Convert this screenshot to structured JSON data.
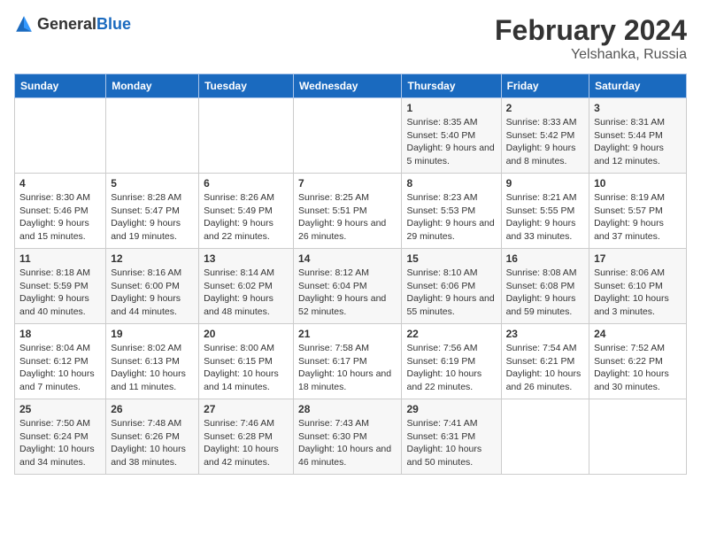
{
  "logo": {
    "text_general": "General",
    "text_blue": "Blue"
  },
  "title": "February 2024",
  "subtitle": "Yelshanka, Russia",
  "days_of_week": [
    "Sunday",
    "Monday",
    "Tuesday",
    "Wednesday",
    "Thursday",
    "Friday",
    "Saturday"
  ],
  "weeks": [
    [
      {
        "day": "",
        "info": ""
      },
      {
        "day": "",
        "info": ""
      },
      {
        "day": "",
        "info": ""
      },
      {
        "day": "",
        "info": ""
      },
      {
        "day": "1",
        "info": "Sunrise: 8:35 AM\nSunset: 5:40 PM\nDaylight: 9 hours\nand 5 minutes."
      },
      {
        "day": "2",
        "info": "Sunrise: 8:33 AM\nSunset: 5:42 PM\nDaylight: 9 hours\nand 8 minutes."
      },
      {
        "day": "3",
        "info": "Sunrise: 8:31 AM\nSunset: 5:44 PM\nDaylight: 9 hours\nand 12 minutes."
      }
    ],
    [
      {
        "day": "4",
        "info": "Sunrise: 8:30 AM\nSunset: 5:46 PM\nDaylight: 9 hours\nand 15 minutes."
      },
      {
        "day": "5",
        "info": "Sunrise: 8:28 AM\nSunset: 5:47 PM\nDaylight: 9 hours\nand 19 minutes."
      },
      {
        "day": "6",
        "info": "Sunrise: 8:26 AM\nSunset: 5:49 PM\nDaylight: 9 hours\nand 22 minutes."
      },
      {
        "day": "7",
        "info": "Sunrise: 8:25 AM\nSunset: 5:51 PM\nDaylight: 9 hours\nand 26 minutes."
      },
      {
        "day": "8",
        "info": "Sunrise: 8:23 AM\nSunset: 5:53 PM\nDaylight: 9 hours\nand 29 minutes."
      },
      {
        "day": "9",
        "info": "Sunrise: 8:21 AM\nSunset: 5:55 PM\nDaylight: 9 hours\nand 33 minutes."
      },
      {
        "day": "10",
        "info": "Sunrise: 8:19 AM\nSunset: 5:57 PM\nDaylight: 9 hours\nand 37 minutes."
      }
    ],
    [
      {
        "day": "11",
        "info": "Sunrise: 8:18 AM\nSunset: 5:59 PM\nDaylight: 9 hours\nand 40 minutes."
      },
      {
        "day": "12",
        "info": "Sunrise: 8:16 AM\nSunset: 6:00 PM\nDaylight: 9 hours\nand 44 minutes."
      },
      {
        "day": "13",
        "info": "Sunrise: 8:14 AM\nSunset: 6:02 PM\nDaylight: 9 hours\nand 48 minutes."
      },
      {
        "day": "14",
        "info": "Sunrise: 8:12 AM\nSunset: 6:04 PM\nDaylight: 9 hours\nand 52 minutes."
      },
      {
        "day": "15",
        "info": "Sunrise: 8:10 AM\nSunset: 6:06 PM\nDaylight: 9 hours\nand 55 minutes."
      },
      {
        "day": "16",
        "info": "Sunrise: 8:08 AM\nSunset: 6:08 PM\nDaylight: 9 hours\nand 59 minutes."
      },
      {
        "day": "17",
        "info": "Sunrise: 8:06 AM\nSunset: 6:10 PM\nDaylight: 10 hours\nand 3 minutes."
      }
    ],
    [
      {
        "day": "18",
        "info": "Sunrise: 8:04 AM\nSunset: 6:12 PM\nDaylight: 10 hours\nand 7 minutes."
      },
      {
        "day": "19",
        "info": "Sunrise: 8:02 AM\nSunset: 6:13 PM\nDaylight: 10 hours\nand 11 minutes."
      },
      {
        "day": "20",
        "info": "Sunrise: 8:00 AM\nSunset: 6:15 PM\nDaylight: 10 hours\nand 14 minutes."
      },
      {
        "day": "21",
        "info": "Sunrise: 7:58 AM\nSunset: 6:17 PM\nDaylight: 10 hours\nand 18 minutes."
      },
      {
        "day": "22",
        "info": "Sunrise: 7:56 AM\nSunset: 6:19 PM\nDaylight: 10 hours\nand 22 minutes."
      },
      {
        "day": "23",
        "info": "Sunrise: 7:54 AM\nSunset: 6:21 PM\nDaylight: 10 hours\nand 26 minutes."
      },
      {
        "day": "24",
        "info": "Sunrise: 7:52 AM\nSunset: 6:22 PM\nDaylight: 10 hours\nand 30 minutes."
      }
    ],
    [
      {
        "day": "25",
        "info": "Sunrise: 7:50 AM\nSunset: 6:24 PM\nDaylight: 10 hours\nand 34 minutes."
      },
      {
        "day": "26",
        "info": "Sunrise: 7:48 AM\nSunset: 6:26 PM\nDaylight: 10 hours\nand 38 minutes."
      },
      {
        "day": "27",
        "info": "Sunrise: 7:46 AM\nSunset: 6:28 PM\nDaylight: 10 hours\nand 42 minutes."
      },
      {
        "day": "28",
        "info": "Sunrise: 7:43 AM\nSunset: 6:30 PM\nDaylight: 10 hours\nand 46 minutes."
      },
      {
        "day": "29",
        "info": "Sunrise: 7:41 AM\nSunset: 6:31 PM\nDaylight: 10 hours\nand 50 minutes."
      },
      {
        "day": "",
        "info": ""
      },
      {
        "day": "",
        "info": ""
      }
    ]
  ]
}
